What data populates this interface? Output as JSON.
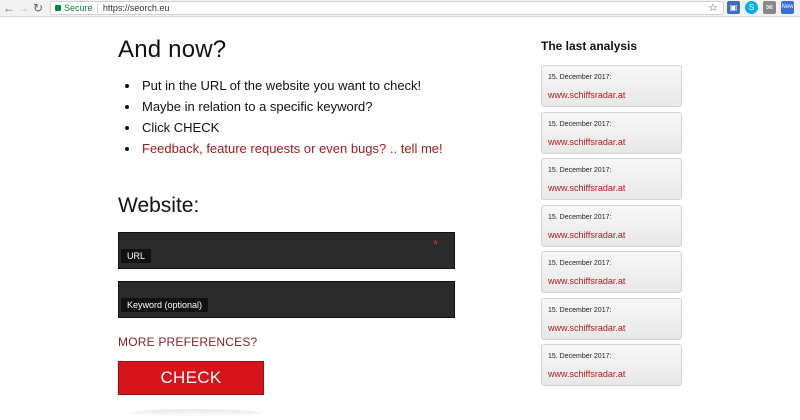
{
  "browser": {
    "secure_label": "Secure",
    "url": "https://seorch.eu",
    "ext_badge": "New"
  },
  "main": {
    "heading": "And now?",
    "list": [
      "Put in the URL of the website you want to check!",
      "Maybe in relation to a specific keyword?",
      "Click CHECK",
      "Feedback, feature requests or even bugs? .. tell me!"
    ],
    "website_heading": "Website:",
    "url_placeholder": "URL",
    "url_required_mark": "*",
    "keyword_placeholder": "Keyword (optional)",
    "more_preferences": "MORE PREFERENCES?",
    "check_label": "CHECK"
  },
  "sidebar": {
    "title": "The last analysis",
    "items": [
      {
        "date": "15. December 2017:",
        "site": "www.schiffsradar.at"
      },
      {
        "date": "15. December 2017:",
        "site": "www.schiffsradar.at"
      },
      {
        "date": "15. December 2017:",
        "site": "www.schiffsradar.at"
      },
      {
        "date": "15. December 2017:",
        "site": "www.schiffsradar.at"
      },
      {
        "date": "15. December 2017:",
        "site": "www.schiffsradar.at"
      },
      {
        "date": "15. December 2017:",
        "site": "www.schiffsradar.at"
      },
      {
        "date": "15. December 2017:",
        "site": "www.schiffsradar.at"
      }
    ]
  },
  "colors": {
    "accent_red": "#d7141a",
    "link_red": "#9e1a1a",
    "field_bg": "#2b2b2b"
  }
}
